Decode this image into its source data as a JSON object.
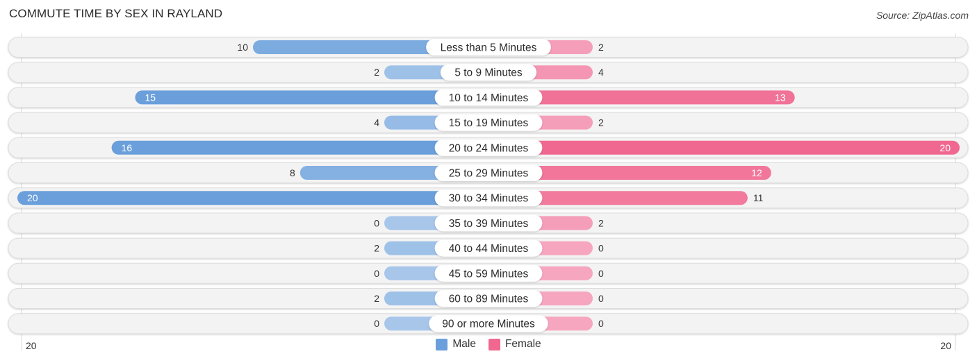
{
  "header": {
    "title": "COMMUTE TIME BY SEX IN RAYLAND",
    "source": "Source: ZipAtlas.com"
  },
  "colors": {
    "male": "#6a9fdb",
    "male_light": "#a7c6ea",
    "female": "#f06890",
    "female_light": "#f6a6bf",
    "track": "#f3f3f3"
  },
  "legend": [
    {
      "label": "Male",
      "color": "#6a9fdb"
    },
    {
      "label": "Female",
      "color": "#f06890"
    }
  ],
  "chart_data": {
    "type": "bar",
    "orientation": "horizontal-diverging",
    "title": "COMMUTE TIME BY SEX IN RAYLAND",
    "categories": [
      "Less than 5 Minutes",
      "5 to 9 Minutes",
      "10 to 14 Minutes",
      "15 to 19 Minutes",
      "20 to 24 Minutes",
      "25 to 29 Minutes",
      "30 to 34 Minutes",
      "35 to 39 Minutes",
      "40 to 44 Minutes",
      "45 to 59 Minutes",
      "60 to 89 Minutes",
      "90 or more Minutes"
    ],
    "series": [
      {
        "name": "Male",
        "side": "left",
        "values": [
          10,
          2,
          15,
          4,
          16,
          8,
          20,
          0,
          2,
          0,
          2,
          0
        ]
      },
      {
        "name": "Female",
        "side": "right",
        "values": [
          2,
          4,
          13,
          2,
          20,
          12,
          11,
          2,
          0,
          0,
          0,
          0
        ]
      }
    ],
    "axis": {
      "left_max_label": "20",
      "right_max_label": "20",
      "range": [
        0,
        20
      ]
    },
    "legend_position": "bottom-center",
    "grid": false
  }
}
